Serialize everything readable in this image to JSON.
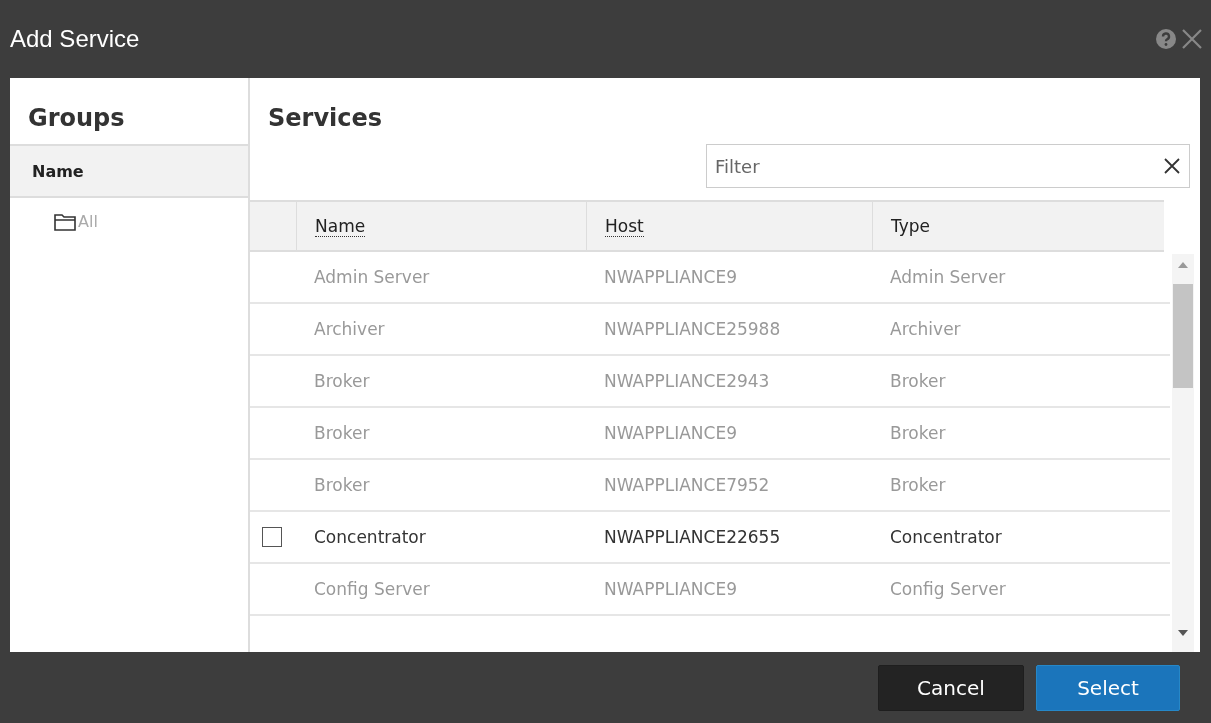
{
  "window": {
    "title": "Add Service"
  },
  "groups": {
    "title": "Groups",
    "column": "Name",
    "items": [
      {
        "label": "All"
      }
    ]
  },
  "services": {
    "title": "Services",
    "filter": {
      "placeholder": "Filter"
    },
    "columns": [
      "Name",
      "Host",
      "Type"
    ],
    "rows": [
      {
        "name": "Admin Server",
        "host": "NWAPPLIANCE9",
        "type": "Admin Server",
        "disabled": true
      },
      {
        "name": "Archiver",
        "host": "NWAPPLIANCE25988",
        "type": "Archiver",
        "disabled": true
      },
      {
        "name": "Broker",
        "host": "NWAPPLIANCE2943",
        "type": "Broker",
        "disabled": true
      },
      {
        "name": "Broker",
        "host": "NWAPPLIANCE9",
        "type": "Broker",
        "disabled": true
      },
      {
        "name": "Broker",
        "host": "NWAPPLIANCE7952",
        "type": "Broker",
        "disabled": true
      },
      {
        "name": "Concentrator",
        "host": "NWAPPLIANCE22655",
        "type": "Concentrator",
        "disabled": false,
        "checked": false
      },
      {
        "name": "Config Server",
        "host": "NWAPPLIANCE9",
        "type": "Config Server",
        "disabled": true
      }
    ]
  },
  "buttons": [
    {
      "label": "Cancel",
      "kind": "secondary"
    },
    {
      "label": "Select",
      "kind": "primary"
    }
  ]
}
